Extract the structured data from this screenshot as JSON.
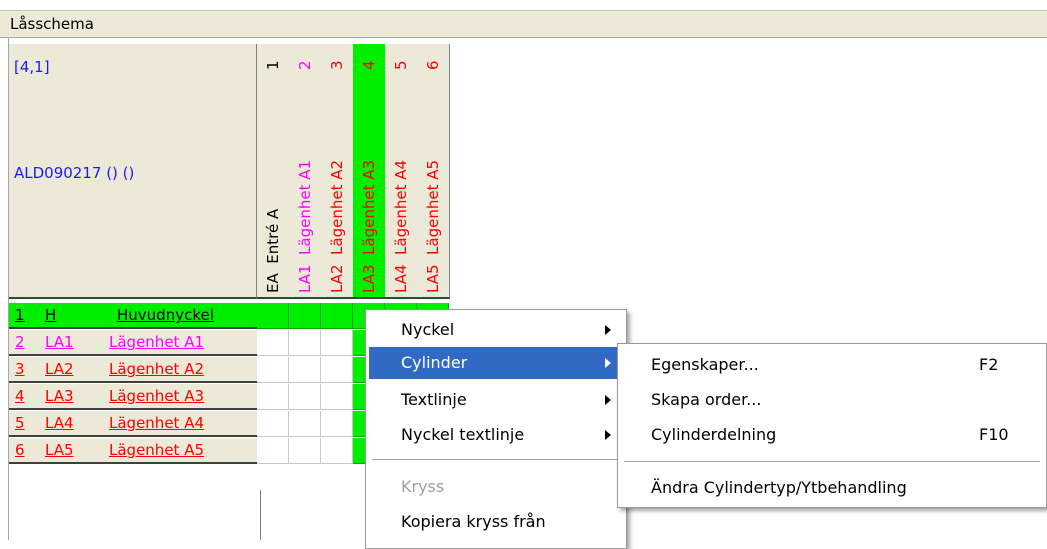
{
  "window": {
    "title": "Låsschema"
  },
  "info": {
    "coord": "[4,1]",
    "system": "ALD090217 () ()"
  },
  "colors": {
    "highlight_green": "#00ee00",
    "menu_highlight": "#316ac5",
    "blue_text": "#1a1aff"
  },
  "columns": [
    {
      "num": "1",
      "code": "EA",
      "name": "Entré A",
      "color": "#000000"
    },
    {
      "num": "2",
      "code": "LA1",
      "name": "Lägenhet A1",
      "color": "#ff00ff"
    },
    {
      "num": "3",
      "code": "LA2",
      "name": "Lägenhet A2",
      "color": "#ff0000"
    },
    {
      "num": "4",
      "code": "LA3",
      "name": "Lägenhet A3",
      "color": "#ff0000"
    },
    {
      "num": "5",
      "code": "LA4",
      "name": "Lägenhet A4",
      "color": "#ff0000"
    },
    {
      "num": "6",
      "code": "LA5",
      "name": "Lägenhet A5",
      "color": "#ff0000"
    }
  ],
  "rows": [
    {
      "num": "1",
      "code": "H",
      "name": "Huvudnyckel",
      "color": "#000000"
    },
    {
      "num": "2",
      "code": "LA1",
      "name": "Lägenhet A1",
      "color": "#ff00ff"
    },
    {
      "num": "3",
      "code": "LA2",
      "name": "Lägenhet A2",
      "color": "#ff0000"
    },
    {
      "num": "4",
      "code": "LA3",
      "name": "Lägenhet A3",
      "color": "#ff0000"
    },
    {
      "num": "5",
      "code": "LA4",
      "name": "Lägenhet A4",
      "color": "#ff0000"
    },
    {
      "num": "6",
      "code": "LA5",
      "name": "Lägenhet A5",
      "color": "#ff0000"
    }
  ],
  "context_menu": {
    "items": [
      {
        "label": "Nyckel",
        "submenu": true
      },
      {
        "label": "Cylinder",
        "submenu": true,
        "highlighted": true
      },
      {
        "label": "Textlinje",
        "submenu": true
      },
      {
        "label": "Nyckel textlinje",
        "submenu": true
      },
      {
        "label": "Kryss",
        "disabled": true
      },
      {
        "label": "Kopiera kryss från"
      }
    ]
  },
  "submenu": {
    "items": [
      {
        "label": "Egenskaper...",
        "shortcut": "F2"
      },
      {
        "label": "Skapa order..."
      },
      {
        "label": "Cylinderdelning",
        "shortcut": "F10"
      },
      {
        "label": "Ändra Cylindertyp/Ytbehandling"
      }
    ]
  }
}
